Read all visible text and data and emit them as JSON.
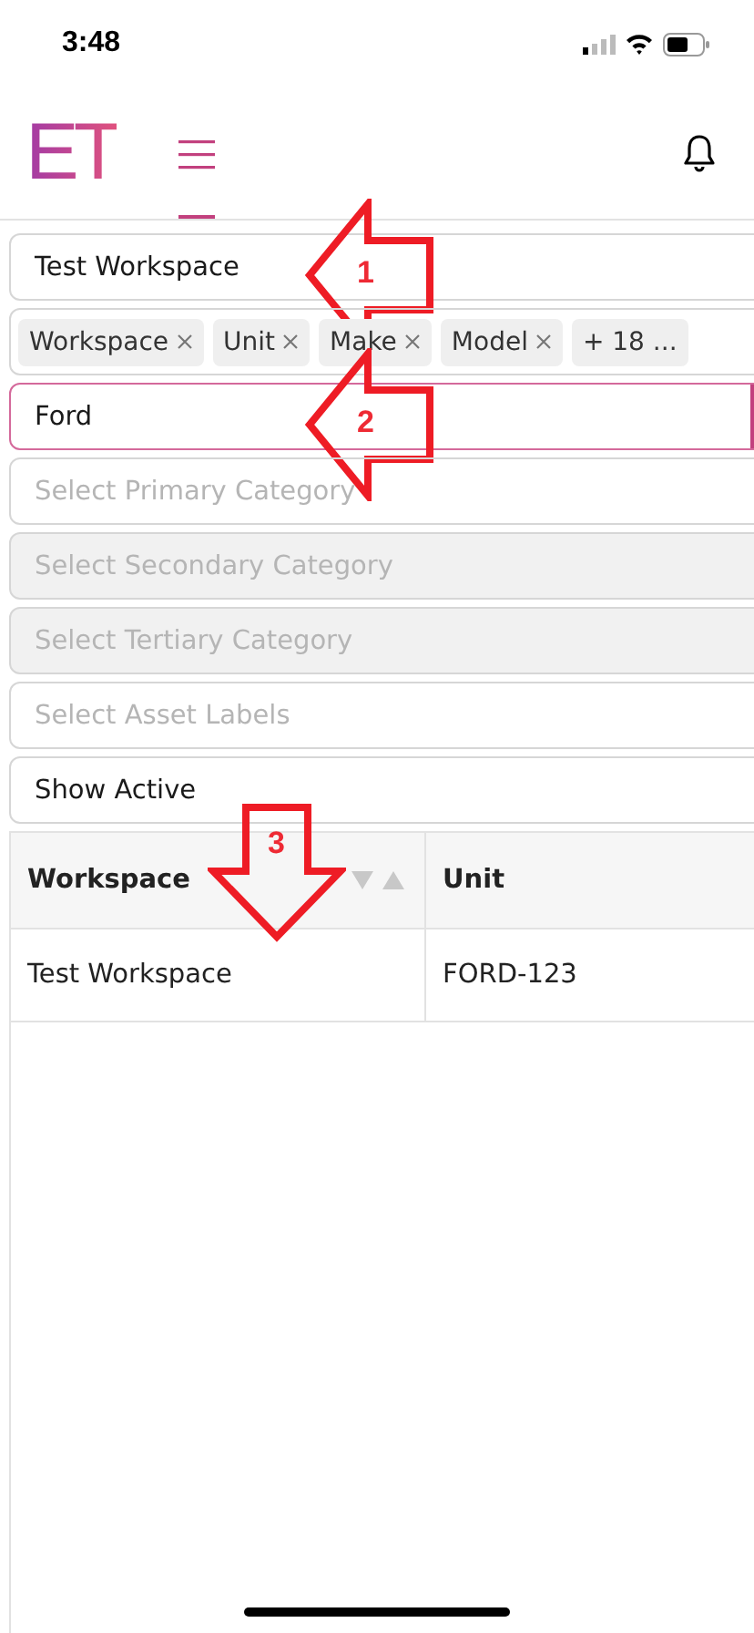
{
  "status_bar": {
    "time": "3:48"
  },
  "header": {
    "logo": "ET",
    "menu_selected": true
  },
  "filters": [
    {
      "kind": "select",
      "value": "Test Workspace",
      "disabled": false,
      "focused": false,
      "callout": {
        "label": "1"
      }
    },
    {
      "kind": "chips",
      "chips": [
        {
          "label": "Workspace",
          "removable": true
        },
        {
          "label": "Unit",
          "removable": true
        },
        {
          "label": "Make",
          "removable": true
        },
        {
          "label": "Model",
          "removable": true
        },
        {
          "label": "+ 18 ...",
          "removable": false
        }
      ]
    },
    {
      "kind": "select",
      "value": "Ford",
      "disabled": false,
      "focused": true,
      "callout": {
        "label": "2"
      }
    },
    {
      "kind": "select",
      "placeholder": "Select Primary Category",
      "disabled": false,
      "focused": false
    },
    {
      "kind": "select",
      "placeholder": "Select Secondary Category",
      "disabled": true,
      "focused": false
    },
    {
      "kind": "select",
      "placeholder": "Select Tertiary Category",
      "disabled": true,
      "focused": false
    },
    {
      "kind": "select",
      "placeholder": "Select Asset Labels",
      "disabled": false,
      "focused": false
    },
    {
      "kind": "select",
      "value": "Show Active",
      "disabled": false,
      "focused": false
    }
  ],
  "table": {
    "columns": [
      {
        "label": "Workspace",
        "sortable": true,
        "callout": {
          "label": "3"
        }
      },
      {
        "label": "Unit"
      }
    ],
    "rows": [
      [
        "Test Workspace",
        "FORD-123"
      ]
    ]
  }
}
